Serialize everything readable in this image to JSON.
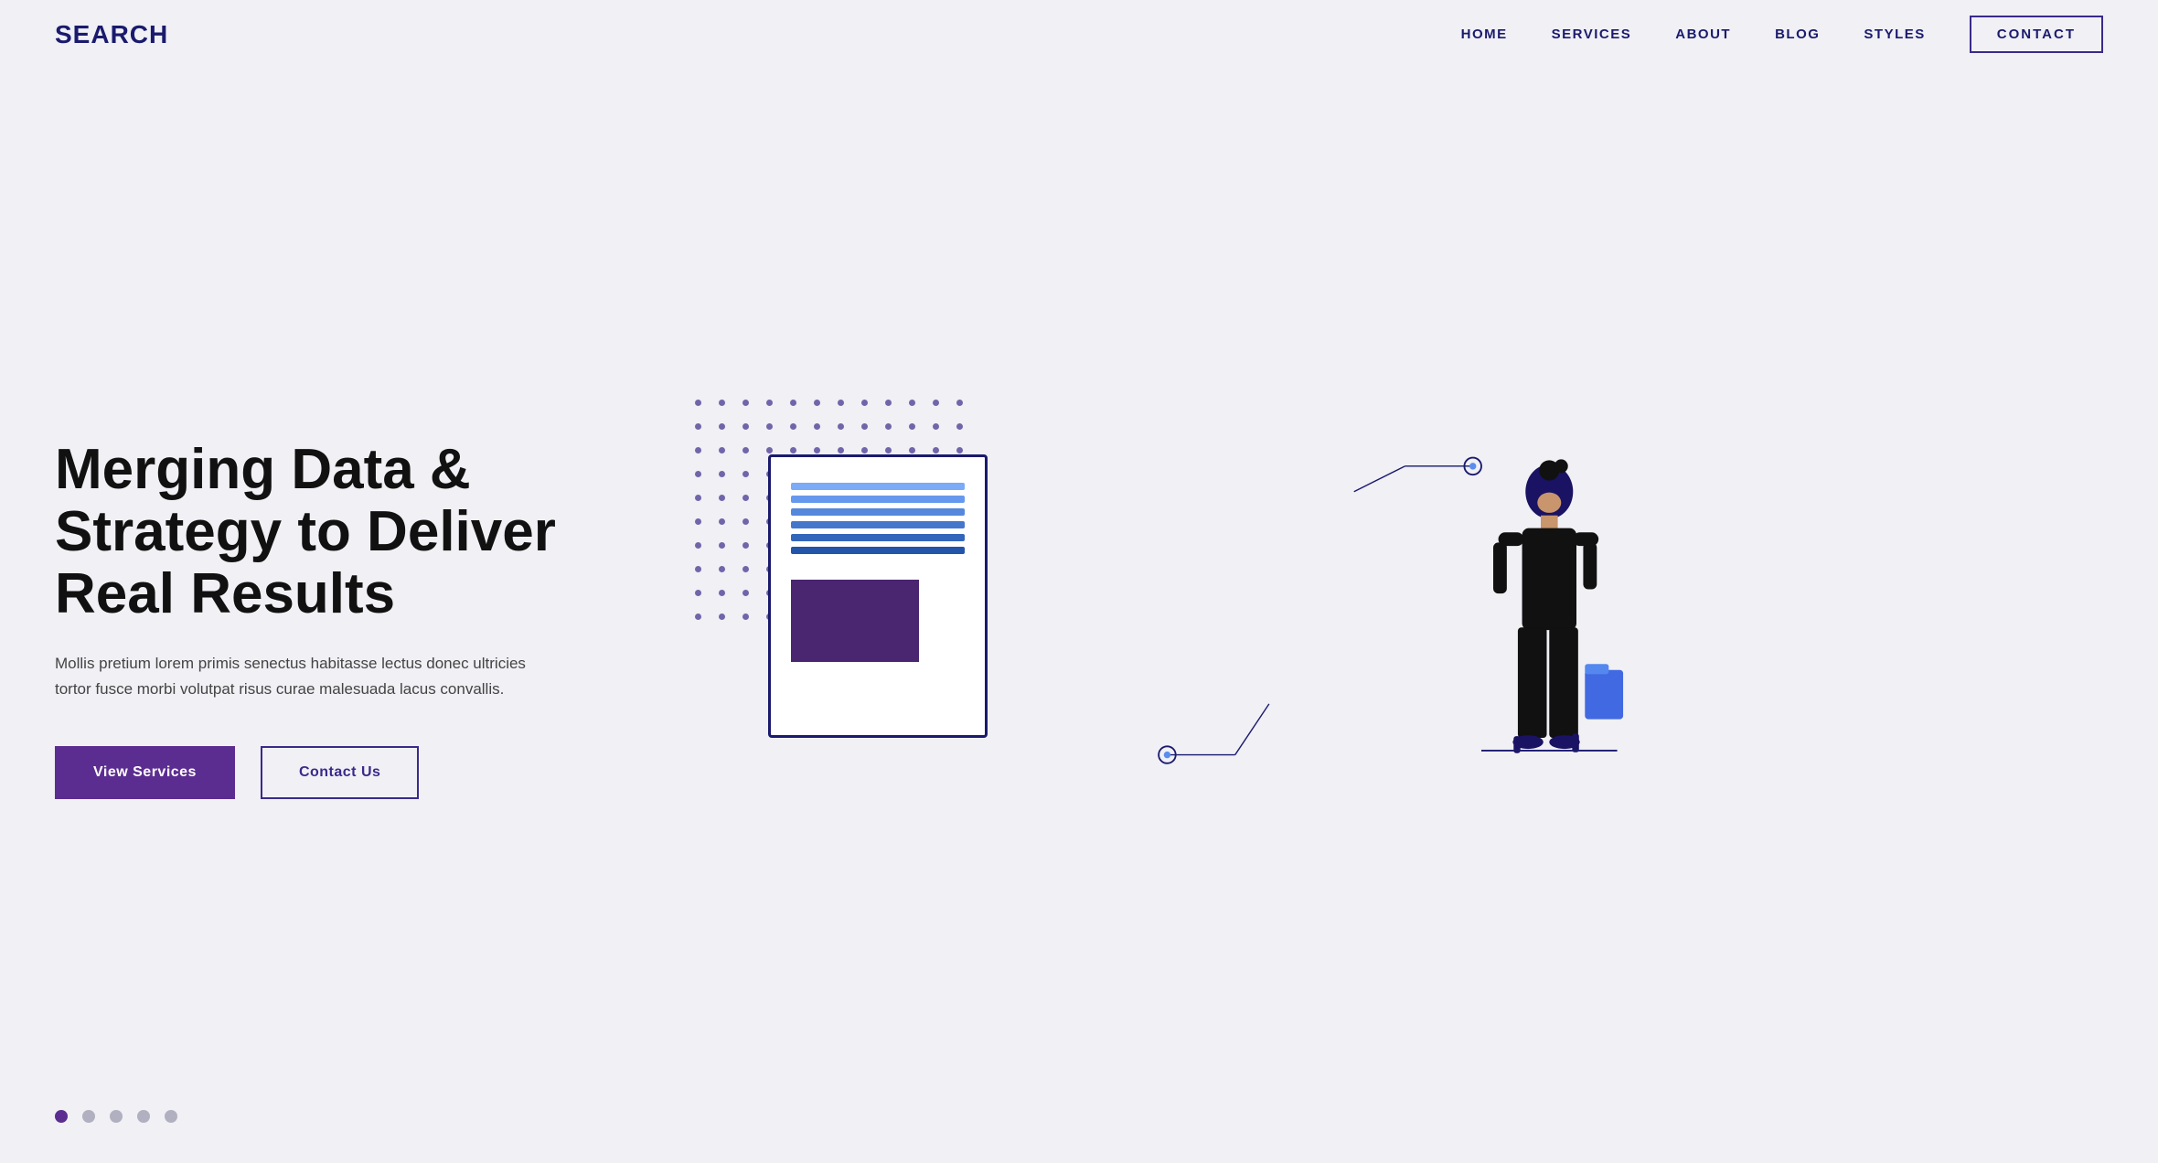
{
  "brand": {
    "logo": "SEARCH"
  },
  "nav": {
    "links": [
      {
        "id": "home",
        "label": "HOME"
      },
      {
        "id": "services",
        "label": "SERVICES"
      },
      {
        "id": "about",
        "label": "ABOUT"
      },
      {
        "id": "blog",
        "label": "BLOG"
      },
      {
        "id": "styles",
        "label": "STYLES"
      },
      {
        "id": "contact",
        "label": "CONTACT"
      }
    ]
  },
  "hero": {
    "title": "Merging Data & Strategy to Deliver Real Results",
    "subtitle": "Mollis pretium lorem primis senectus habitasse lectus donec ultricies tortor fusce morbi volutpat risus curae malesuada lacus convallis.",
    "btn_primary": "View Services",
    "btn_secondary": "Contact Us"
  },
  "colors": {
    "brand_dark": "#1a1a6e",
    "brand_purple": "#5c2d91",
    "accent_blue": "#5b8dee",
    "bg": "#f0f0f5"
  }
}
